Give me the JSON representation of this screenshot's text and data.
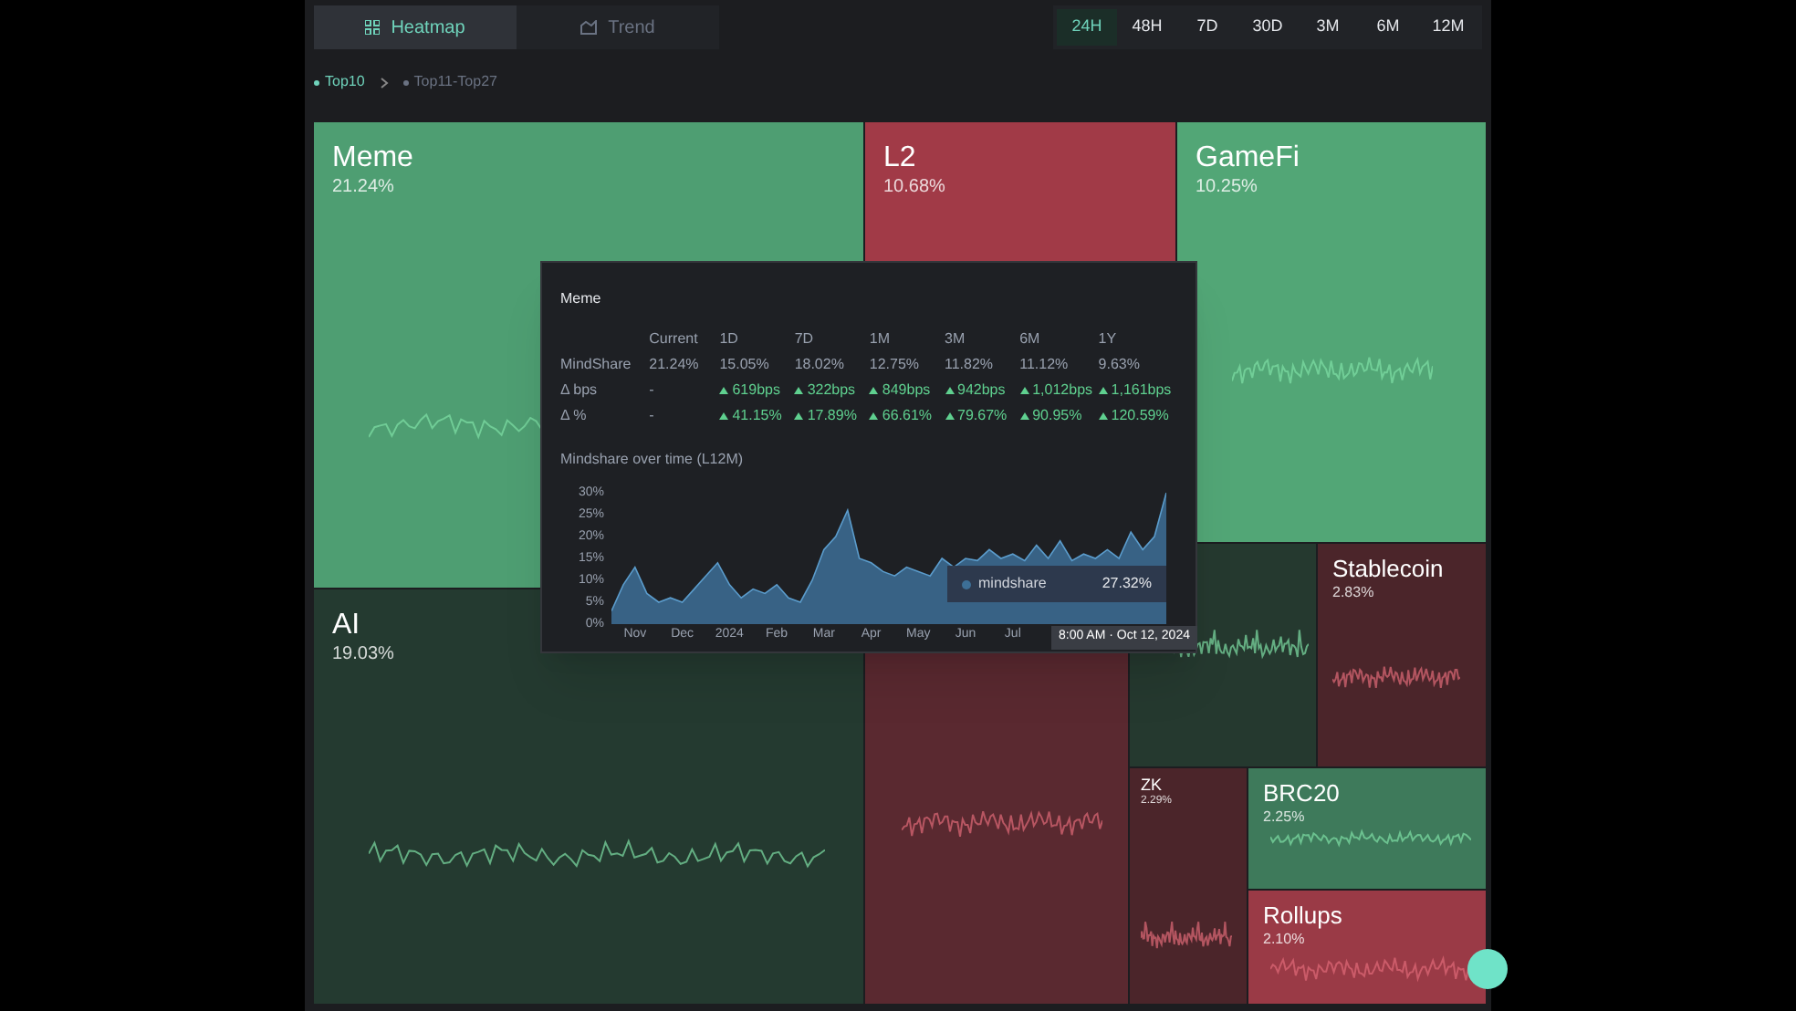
{
  "view_tabs": [
    {
      "label": "Heatmap",
      "selected": true
    },
    {
      "label": "Trend",
      "selected": false
    }
  ],
  "time_ranges": [
    {
      "label": "24H",
      "selected": true
    },
    {
      "label": "48H",
      "selected": false
    },
    {
      "label": "7D",
      "selected": false
    },
    {
      "label": "30D",
      "selected": false
    },
    {
      "label": "3M",
      "selected": false
    },
    {
      "label": "6M",
      "selected": false
    },
    {
      "label": "12M",
      "selected": false
    }
  ],
  "breadcrumb": [
    {
      "label": "Top10",
      "selected": true
    },
    {
      "label": "Top11-Top27",
      "selected": false
    }
  ],
  "treemap": {
    "tiles": [
      {
        "name": "Meme",
        "share": "21.24%",
        "color": "#4e9e72",
        "kind": "gain"
      },
      {
        "name": "L2",
        "share": "10.68%",
        "color": "#a13a47"
      },
      {
        "name": "GameFi",
        "share": "10.25%",
        "color": "#52a676",
        "kind": "gain"
      },
      {
        "name": "AI",
        "share": "19.03%",
        "color": "#243a30",
        "kind": "gain"
      },
      {
        "color": "#5a2930",
        "kind": "loss"
      },
      {
        "color": "#25392f",
        "kind": "gain"
      },
      {
        "name": "Stablecoin",
        "share": "2.83%",
        "color": "#4b252a",
        "kind": "loss"
      },
      {
        "name": "ZK",
        "share": "2.29%",
        "color": "#4b252a",
        "kind": "loss"
      },
      {
        "name": "BRC20",
        "share": "2.25%",
        "color": "#3e7a5b",
        "kind": "gain"
      },
      {
        "name": "Rollups",
        "share": "2.10%",
        "color": "#9a3a46",
        "kind": "loss"
      }
    ]
  },
  "tooltip": {
    "title": "Meme",
    "columns": [
      "Current",
      "1D",
      "7D",
      "1M",
      "3M",
      "6M",
      "1Y"
    ],
    "rows": [
      {
        "label": "MindShare",
        "cells": [
          {
            "value": "21.24%",
            "kind": "plain"
          },
          {
            "value": "15.05%",
            "kind": "plain"
          },
          {
            "value": "18.02%",
            "kind": "plain"
          },
          {
            "value": "12.75%",
            "kind": "plain"
          },
          {
            "value": "11.82%",
            "kind": "plain"
          },
          {
            "value": "11.12%",
            "kind": "plain"
          },
          {
            "value": "9.63%",
            "kind": "plain"
          }
        ]
      },
      {
        "label": "Δ bps",
        "cells": [
          {
            "value": "-",
            "kind": "plain"
          },
          {
            "value": "619bps",
            "kind": "gain"
          },
          {
            "value": "322bps",
            "kind": "gain"
          },
          {
            "value": "849bps",
            "kind": "gain"
          },
          {
            "value": "942bps",
            "kind": "gain"
          },
          {
            "value": "1,012bps",
            "kind": "gain"
          },
          {
            "value": "1,161bps",
            "kind": "gain"
          }
        ]
      },
      {
        "label": "Δ %",
        "cells": [
          {
            "value": "-",
            "kind": "plain"
          },
          {
            "value": "41.15%",
            "kind": "gain"
          },
          {
            "value": "17.89%",
            "kind": "gain"
          },
          {
            "value": "66.61%",
            "kind": "gain"
          },
          {
            "value": "79.67%",
            "kind": "gain"
          },
          {
            "value": "90.95%",
            "kind": "gain"
          },
          {
            "value": "120.59%",
            "kind": "gain"
          }
        ]
      }
    ],
    "chart_title": "Mindshare over time (L12M)",
    "chart_data": {
      "type": "area",
      "series": [
        {
          "name": "mindshare",
          "color": "#3d6f96",
          "values": [
            3,
            9,
            13,
            7,
            5,
            6,
            5,
            8,
            11,
            14,
            9,
            6,
            8,
            7,
            9,
            6,
            5,
            10,
            17,
            20,
            26,
            15,
            14,
            12,
            11,
            13,
            12,
            11,
            15,
            13,
            15,
            14.5,
            17,
            15,
            16,
            14.5,
            18,
            15,
            19,
            14.5,
            16,
            15,
            17,
            15,
            21,
            17,
            20,
            30
          ]
        }
      ],
      "categories": [
        null,
        null,
        "Nov",
        null,
        null,
        null,
        "Dec",
        null,
        null,
        null,
        "2024",
        null,
        null,
        null,
        "Feb",
        null,
        null,
        null,
        "Mar",
        null,
        null,
        null,
        "Apr",
        null,
        null,
        null,
        "May",
        null,
        null,
        null,
        "Jun",
        null,
        null,
        null,
        "Jul",
        null,
        null,
        null,
        null,
        null,
        null,
        null,
        null,
        null,
        null,
        null,
        null,
        null
      ],
      "ylim": [
        0,
        30
      ],
      "yticks": [
        {
          "value": 0,
          "label": "0%"
        },
        {
          "value": 5,
          "label": "5%"
        },
        {
          "value": 10,
          "label": "10%"
        },
        {
          "value": 15,
          "label": "15%"
        },
        {
          "value": 20,
          "label": "20%"
        },
        {
          "value": 25,
          "label": "25%"
        },
        {
          "value": 30,
          "label": "30%"
        }
      ]
    },
    "hover": {
      "value": "27.32%",
      "time": "8:00 AM · Oct 12, 2024"
    }
  }
}
